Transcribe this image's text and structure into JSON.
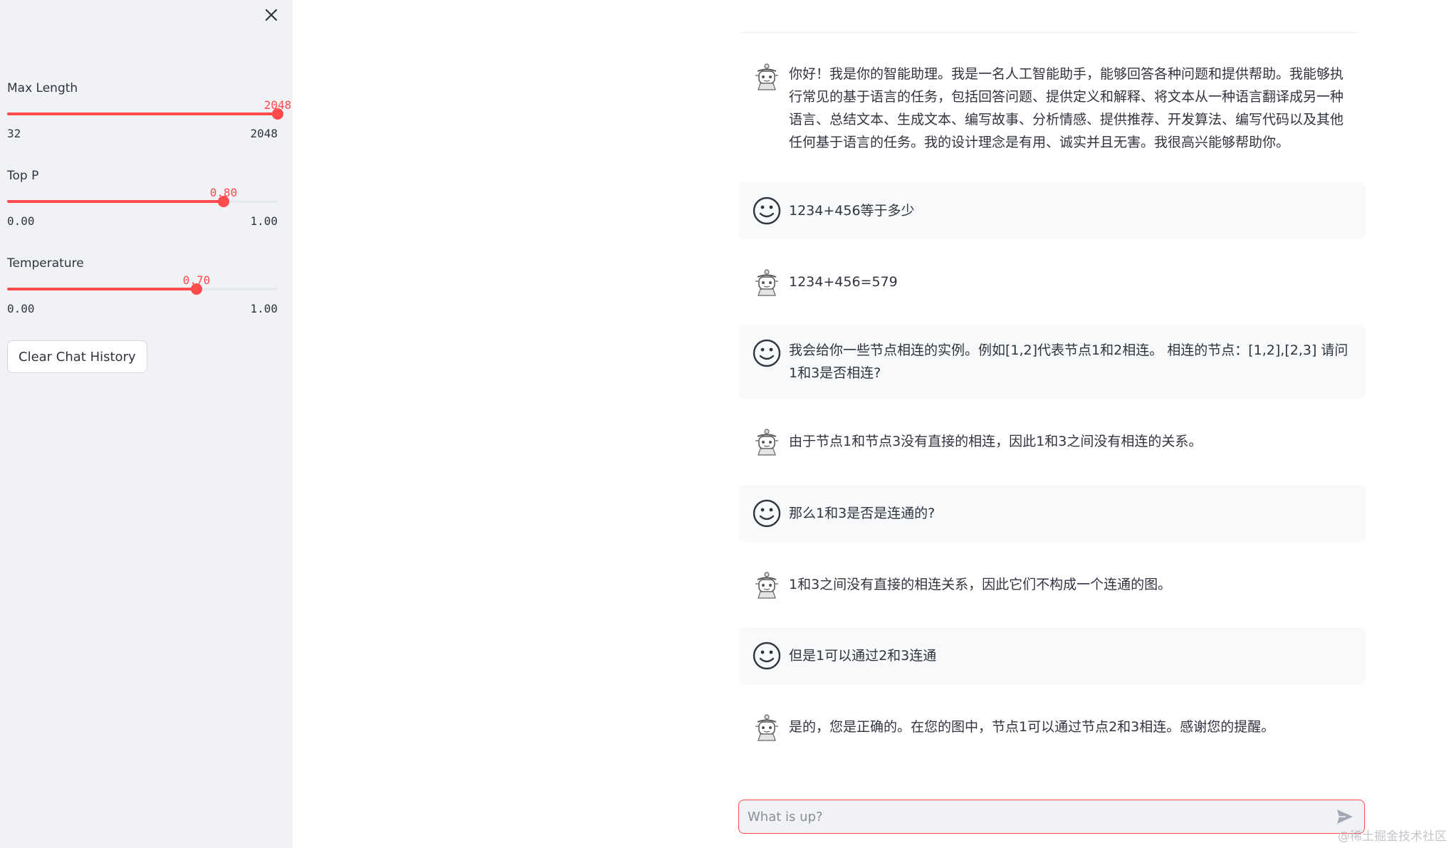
{
  "sidebar": {
    "close_label": "×",
    "sliders": [
      {
        "label": "Max Length",
        "value": "2048",
        "min": "32",
        "max": "2048",
        "fraction": 1.0
      },
      {
        "label": "Top P",
        "value": "0.80",
        "min": "0.00",
        "max": "1.00",
        "fraction": 0.8
      },
      {
        "label": "Temperature",
        "value": "0.70",
        "min": "0.00",
        "max": "1.00",
        "fraction": 0.7
      }
    ],
    "clear_button": "Clear Chat History"
  },
  "chat": {
    "messages": [
      {
        "role": "assistant",
        "avatar": "robot-avatar-icon",
        "text": "你好！我是你的智能助理。我是一名人工智能助手，能够回答各种问题和提供帮助。我能够执行常见的基于语言的任务，包括回答问题、提供定义和解释、将文本从一种语言翻译成另一种语言、总结文本、生成文本、编写故事、分析情感、提供推荐、开发算法、编写代码以及其他任何基于语言的任务。我的设计理念是有用、诚实并且无害。我很高兴能够帮助你。"
      },
      {
        "role": "user",
        "avatar": "smiley-avatar-icon",
        "text": "1234+456等于多少"
      },
      {
        "role": "assistant",
        "avatar": "robot-avatar-icon",
        "text": "1234+456=579"
      },
      {
        "role": "user",
        "avatar": "smiley-avatar-icon",
        "text": "我会给你一些节点相连的实例。例如[1,2]代表节点1和2相连。 相连的节点：[1,2],[2,3] 请问1和3是否相连?"
      },
      {
        "role": "assistant",
        "avatar": "robot-avatar-icon",
        "text": "由于节点1和节点3没有直接的相连，因此1和3之间没有相连的关系。"
      },
      {
        "role": "user",
        "avatar": "smiley-avatar-icon",
        "text": "那么1和3是否是连通的?"
      },
      {
        "role": "assistant",
        "avatar": "robot-avatar-icon",
        "text": "1和3之间没有直接的相连关系，因此它们不构成一个连通的图。"
      },
      {
        "role": "user",
        "avatar": "smiley-avatar-icon",
        "text": "但是1可以通过2和3连通"
      },
      {
        "role": "assistant",
        "avatar": "robot-avatar-icon",
        "text": "是的，您是正确的。在您的图中，节点1可以通过节点2和3相连。感谢您的提醒。"
      }
    ],
    "input_placeholder": "What is up?",
    "send_icon": "send-icon"
  },
  "watermark": "@稀土掘金技术社区",
  "colors": {
    "accent": "#ff4b4b",
    "sidebar_bg": "#f0f2f6",
    "user_msg_bg": "#f8f9fb",
    "text": "#31333f"
  }
}
